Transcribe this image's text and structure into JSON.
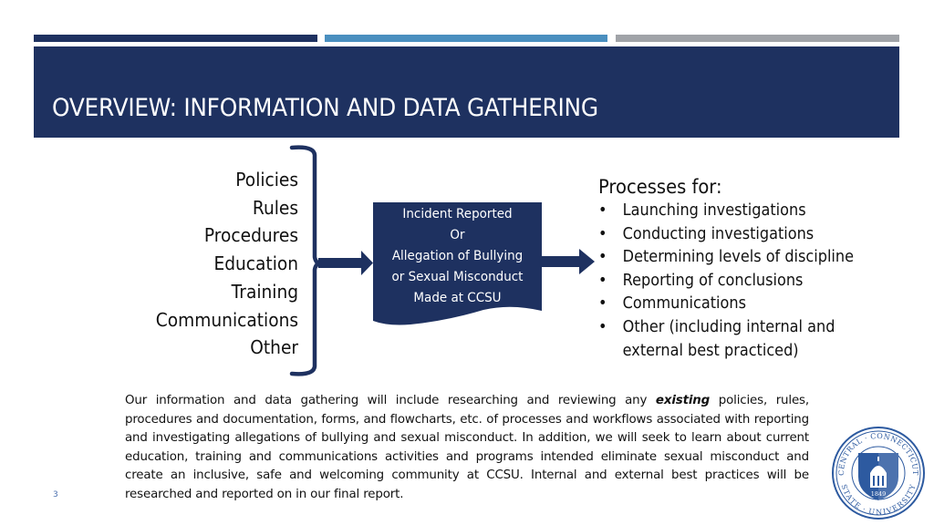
{
  "slide": {
    "title": "OVERVIEW:  INFORMATION AND DATA GATHERING",
    "page_number": "3",
    "colors": {
      "navy": "#1e3160",
      "light_blue": "#4a8fbf",
      "gray": "#a0a3a8"
    }
  },
  "left_list": {
    "items": [
      "Policies",
      "Rules",
      "Procedures",
      "Education",
      "Training",
      "Communications",
      "Other"
    ]
  },
  "center_box": {
    "lines": [
      "Incident Reported",
      "Or",
      "Allegation of Bullying",
      "or Sexual Misconduct",
      "Made at CCSU"
    ]
  },
  "processes": {
    "title": "Processes for:",
    "items": [
      {
        "text": "Launching investigations"
      },
      {
        "text": "Conducting investigations"
      },
      {
        "text": "Determining levels of discipline"
      },
      {
        "text": "Reporting of conclusions"
      },
      {
        "text": "Communications"
      },
      {
        "text": "Other (including internal and",
        "continuation": "external best practiced)"
      }
    ],
    "bullet": "•"
  },
  "paragraph": {
    "before": "Our information and data gathering will include researching and reviewing any ",
    "emphasis": "existing",
    "after": " policies, rules, procedures and documentation, forms, and flowcharts, etc. of processes and workflows associated with reporting and investigating allegations of bullying and sexual misconduct.  In addition, we will seek to learn about current education, training and communications activities and programs intended eliminate sexual misconduct and create an inclusive, safe and welcoming community at CCSU.  Internal and external best practices will be researched and reported on in our final report."
  },
  "seal": {
    "top_text": "· CENTRAL · CONNECTICUT ·",
    "bottom_text": "STATE · UNIVERSITY",
    "year": "1849"
  }
}
